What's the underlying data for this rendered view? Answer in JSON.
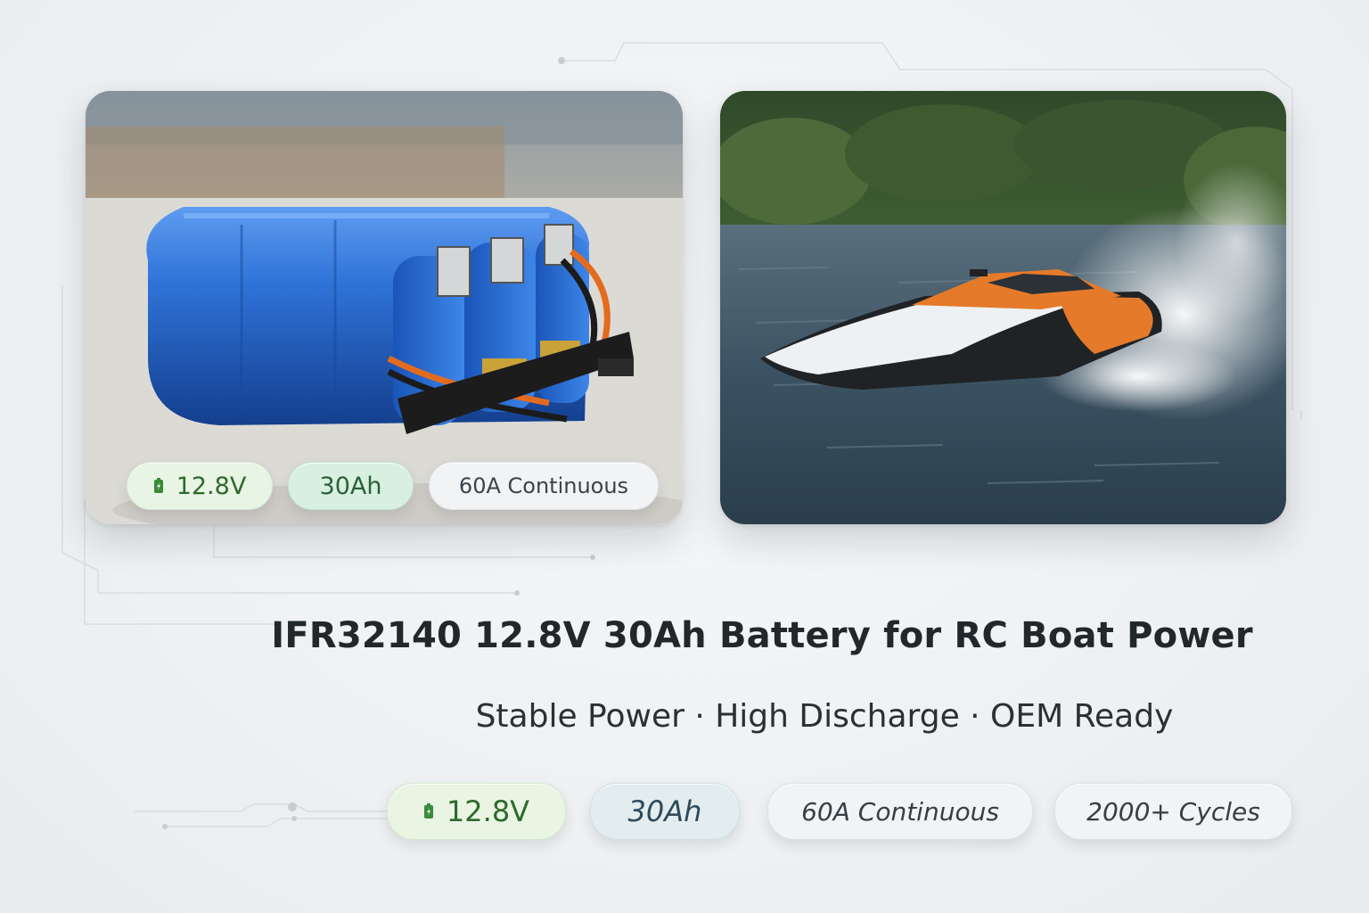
{
  "product": {
    "title": "IFR32140 12.8V 30Ah Battery for RC Boat Power",
    "subtitle": "Stable Power · High Discharge · OEM Ready"
  },
  "card_badges": {
    "voltage": "12.8V",
    "capacity": "30Ah",
    "current": "60A Continuous"
  },
  "badges": {
    "voltage": "12.8V",
    "capacity": "30Ah",
    "current": "60A Continuous",
    "cycles": "2000+ Cycles"
  },
  "colors": {
    "battery_blue": "#1f5fc4",
    "accent_green": "#2e6a2c",
    "boat_orange": "#e57a2a",
    "water": "#33495a"
  },
  "icons": {
    "voltage": "battery-bolt-icon"
  }
}
